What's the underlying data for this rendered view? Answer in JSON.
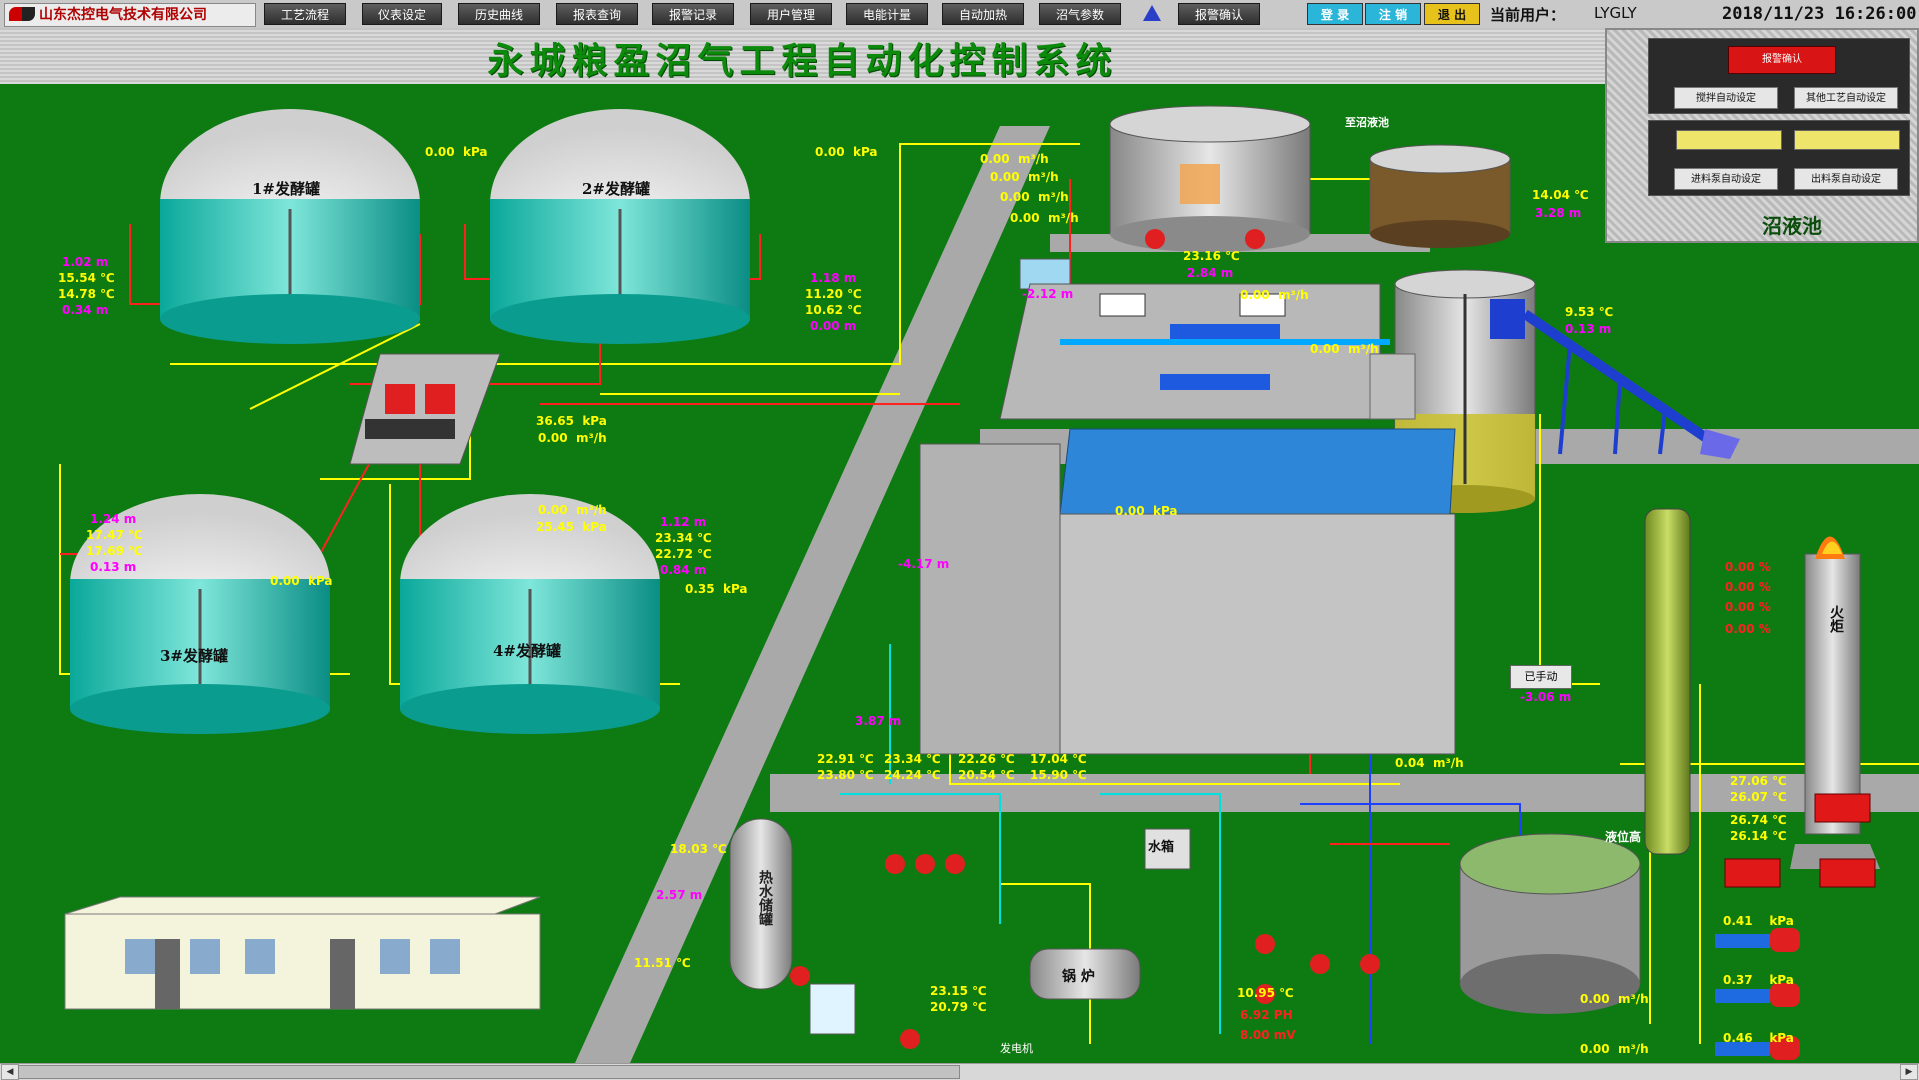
{
  "company": "山东杰控电气技术有限公司",
  "nav": [
    "工艺流程",
    "仪表设定",
    "历史曲线",
    "报表查询",
    "报警记录",
    "用户管理",
    "电能计量",
    "自动加热",
    "沼气参数",
    "报警确认"
  ],
  "auth": {
    "login": "登 录",
    "logout_user": "注 销",
    "exit": "退 出"
  },
  "user_label": "当前用户：",
  "user": "LYGLY",
  "datetime": "2018/11/23 16:26:00",
  "title": "永城粮盈沼气工程自动化控制系统",
  "control_panel": {
    "red_button": "报警确认",
    "btn_stir": "搅拌自动设定",
    "btn_other": "其他工艺自动设定",
    "btn_feed_in": "进料泵自动设定",
    "btn_feed_out": "出料泵自动设定",
    "title": "沼液池"
  },
  "tanks": {
    "t1": "1#发酵罐",
    "t2": "2#发酵罐",
    "t3": "3#发酵罐",
    "t4": "4#发酵罐"
  },
  "labels": {
    "to_pool": "至沼液池",
    "hot_water": "热水储罐",
    "boiler": "锅 炉",
    "water_tank": "水箱",
    "generator": "发电机",
    "flare": "火炬",
    "liquid_level": "液位高",
    "manual": "已手动"
  },
  "readings": {
    "t1_kpa": "0.00",
    "t2_kpa": "0.00",
    "unit_kpa": "kPa",
    "t1": [
      "1.02 m",
      "15.54 ℃",
      "14.78 ℃",
      "0.34 m"
    ],
    "t2": [
      "1.18 m",
      "11.20 ℃",
      "10.62 ℃",
      "0.00 m"
    ],
    "t3": [
      "1.24 m",
      "17.47 ℃",
      "17.69 ℃",
      "0.13 m"
    ],
    "t4": [
      "1.12 m",
      "23.34 ℃",
      "22.72 ℃",
      "0.84 m"
    ],
    "t3_kpa": "0.00",
    "t4_kpa": "0.35",
    "mid_kpa1": "36.65",
    "mid_flow1": "0.00",
    "mid_flow2": "0.00",
    "mid_kpa2": "25.45",
    "flows_top": [
      "0.00",
      "0.00",
      "0.00",
      "0.00"
    ],
    "unit_flow": "m³/h",
    "pre_tank": [
      "23.16 ℃",
      "2.84 m"
    ],
    "pre_flow": "0.00",
    "neg_m": "-2.12 m",
    "pool_right": [
      "14.04 ℃",
      "3.28 m"
    ],
    "hydro": [
      "9.53 ℃",
      "0.13 m"
    ],
    "flow_hydro": "0.00",
    "pump_area_kpa": "0.00",
    "pump_area_m": "-4.17 m",
    "pump_area_m2": "3.87 m",
    "temps_row1": [
      "22.91 ℃",
      "23.34 ℃",
      "22.26 ℃",
      "17.04 ℃"
    ],
    "temps_row2": [
      "23.80 ℃",
      "24.24 ℃",
      "20.54 ℃",
      "15.90 ℃"
    ],
    "gas_flow": "0.04",
    "desulf": [
      "0.00 %",
      "0.00 %",
      "0.00 %",
      "0.00 %"
    ],
    "manual_m": "-3.06 m",
    "gas_temps": [
      "27.06 ℃",
      "26.07 ℃",
      "26.74 ℃",
      "26.14 ℃"
    ],
    "gas_kpa": [
      "0.41",
      "0.37",
      "0.46"
    ],
    "hot_temp": "18.03 ℃",
    "hot_m": "2.57 m",
    "hot_low": "11.51 ℃",
    "boiler_t": [
      "23.15 ℃",
      "20.79 ℃"
    ],
    "bottom_left": [
      "10.95 ℃",
      "6.92 PH",
      "8.00 mV"
    ],
    "bottom_flows": [
      "0.00",
      "0.00"
    ]
  }
}
